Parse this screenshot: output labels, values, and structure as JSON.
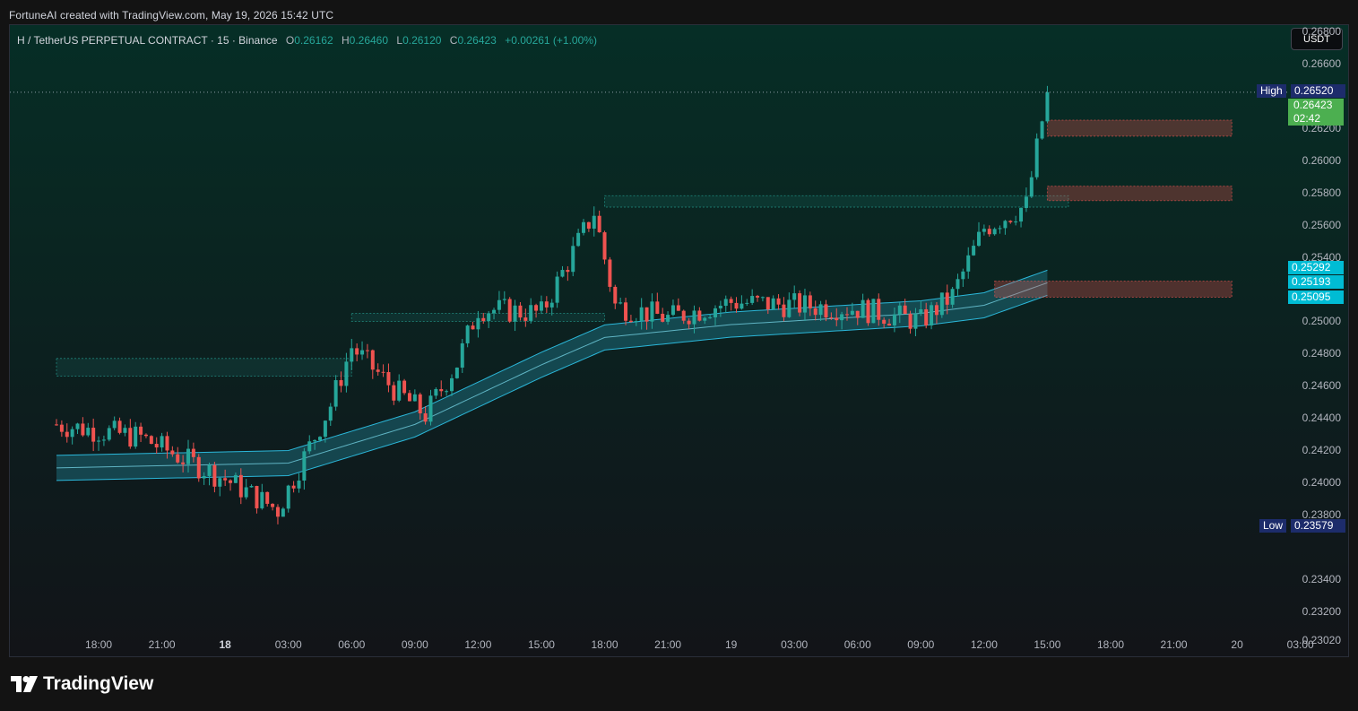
{
  "caption": "FortuneAI created with TradingView.com, May 19, 2026 15:42 UTC",
  "legend": {
    "symbol": "H / TetherUS PERPETUAL CONTRACT · 15 · Binance",
    "o_label": "O",
    "o": "0.26162",
    "h_label": "H",
    "h": "0.26460",
    "l_label": "L",
    "l": "0.26120",
    "c_label": "C",
    "c": "0.26423",
    "change": "+0.00261 (+1.00%)"
  },
  "currency_button": "USDT",
  "price_tags": {
    "high_label": "High",
    "high_value": "0.26520",
    "last_value": "0.26423",
    "countdown": "02:42",
    "level1": "0.25292",
    "level2": "0.25193",
    "level3": "0.25095",
    "low_label": "Low",
    "low_value": "0.23579"
  },
  "y_axis_labels": [
    "0.26800",
    "0.26600",
    "0.26200",
    "0.26000",
    "0.25800",
    "0.25600",
    "0.25400",
    "0.25000",
    "0.24800",
    "0.24600",
    "0.24400",
    "0.24200",
    "0.24000",
    "0.23800",
    "0.23400",
    "0.23200",
    "0.23020"
  ],
  "x_axis_labels": [
    {
      "t": "18:00",
      "bold": false
    },
    {
      "t": "21:00",
      "bold": false
    },
    {
      "t": "18",
      "bold": true
    },
    {
      "t": "03:00",
      "bold": false
    },
    {
      "t": "06:00",
      "bold": false
    },
    {
      "t": "09:00",
      "bold": false
    },
    {
      "t": "12:00",
      "bold": false
    },
    {
      "t": "15:00",
      "bold": false
    },
    {
      "t": "18:00",
      "bold": false
    },
    {
      "t": "21:00",
      "bold": false
    },
    {
      "t": "19",
      "bold": false
    },
    {
      "t": "03:00",
      "bold": false
    },
    {
      "t": "06:00",
      "bold": false
    },
    {
      "t": "09:00",
      "bold": false
    },
    {
      "t": "12:00",
      "bold": false
    },
    {
      "t": "15:00",
      "bold": false
    },
    {
      "t": "18:00",
      "bold": false
    },
    {
      "t": "21:00",
      "bold": false
    },
    {
      "t": "20",
      "bold": false
    },
    {
      "t": "03:00",
      "bold": false
    }
  ],
  "brand": "TradingView",
  "colors": {
    "up": "#26a69a",
    "down": "#ef5350",
    "band": "#2bb7d9",
    "tag_blue": "#1d2c6b",
    "tag_cyan": "#00bcd4",
    "tag_green": "#4caf50"
  },
  "chart_data": {
    "type": "candlestick",
    "interval": "15",
    "y_range": [
      0.2292,
      0.2684
    ],
    "high": 0.2652,
    "low": 0.23579,
    "last": 0.26423,
    "anchors": [
      {
        "time": "17 16:00",
        "price": 0.2436
      },
      {
        "time": "17 20:00",
        "price": 0.2428
      },
      {
        "time": "18 00:00",
        "price": 0.2402
      },
      {
        "time": "18 02:30",
        "price": 0.2383
      },
      {
        "time": "18 05:00",
        "price": 0.2448
      },
      {
        "time": "18 06:00",
        "price": 0.2484
      },
      {
        "time": "18 08:00",
        "price": 0.2458
      },
      {
        "time": "18 09:30",
        "price": 0.2442
      },
      {
        "time": "18 11:00",
        "price": 0.2474
      },
      {
        "time": "18 12:00",
        "price": 0.2508
      },
      {
        "time": "18 15:00",
        "price": 0.2505
      },
      {
        "time": "18 17:30",
        "price": 0.2568
      },
      {
        "time": "18 18:30",
        "price": 0.251
      },
      {
        "time": "18 21:00",
        "price": 0.2502
      },
      {
        "time": "19 00:00",
        "price": 0.2512
      },
      {
        "time": "19 06:00",
        "price": 0.2508
      },
      {
        "time": "19 09:00",
        "price": 0.25
      },
      {
        "time": "19 10:30",
        "price": 0.2516
      },
      {
        "time": "19 12:00",
        "price": 0.2558
      },
      {
        "time": "19 14:00",
        "price": 0.2572
      },
      {
        "time": "19 15:00",
        "price": 0.2642
      }
    ],
    "band": [
      {
        "time": "17 16:00",
        "price": 0.2409
      },
      {
        "time": "18 03:00",
        "price": 0.2412
      },
      {
        "time": "18 09:00",
        "price": 0.2436
      },
      {
        "time": "18 15:00",
        "price": 0.2473
      },
      {
        "time": "18 18:00",
        "price": 0.249
      },
      {
        "time": "19 00:00",
        "price": 0.2498
      },
      {
        "time": "19 09:00",
        "price": 0.2505
      },
      {
        "time": "19 12:00",
        "price": 0.251
      },
      {
        "time": "19 15:00",
        "price": 0.2524
      }
    ],
    "zones": [
      {
        "from": "17 16:00",
        "to": "18 06:00",
        "low": 0.2466,
        "high": 0.2477,
        "type": "demand"
      },
      {
        "from": "18 06:00",
        "to": "18 18:00",
        "low": 0.25,
        "high": 0.2505,
        "type": "demand"
      },
      {
        "from": "18 18:00",
        "to": "19 16:00",
        "low": 0.2571,
        "high": 0.2578,
        "type": "demand"
      },
      {
        "from": "19 15:00",
        "to": "19 23:45",
        "low": 0.2575,
        "high": 0.2584,
        "type": "supply"
      },
      {
        "from": "19 15:00",
        "to": "19 23:45",
        "low": 0.2615,
        "high": 0.2625,
        "type": "supply"
      },
      {
        "from": "19 12:30",
        "to": "19 23:45",
        "low": 0.2515,
        "high": 0.2525,
        "type": "supply"
      }
    ]
  }
}
